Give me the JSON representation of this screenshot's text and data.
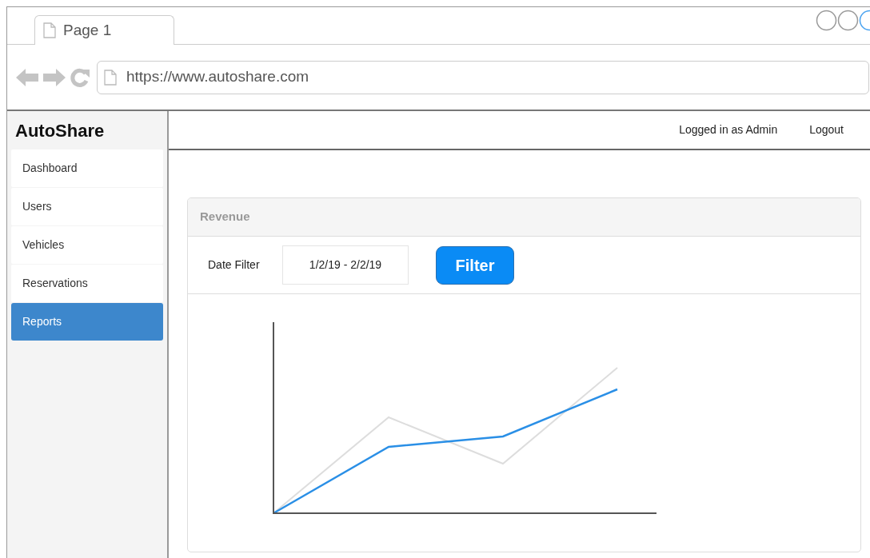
{
  "browser": {
    "tab": {
      "label": "Page 1"
    },
    "url": "https://www.autoshare.com"
  },
  "app": {
    "brand": "AutoShare",
    "header": {
      "user": "Logged in as Admin",
      "logout": "Logout"
    },
    "sidebar": {
      "items": [
        {
          "label": "Dashboard",
          "selected": false
        },
        {
          "label": "Users",
          "selected": false
        },
        {
          "label": "Vehicles",
          "selected": false
        },
        {
          "label": "Reservations",
          "selected": false
        },
        {
          "label": "Reports",
          "selected": true
        }
      ]
    },
    "panel": {
      "title": "Revenue",
      "filter_label": "Date Filter",
      "date_range": "1/2/19 - 2/2/19",
      "filter_button": "Filter"
    }
  }
}
